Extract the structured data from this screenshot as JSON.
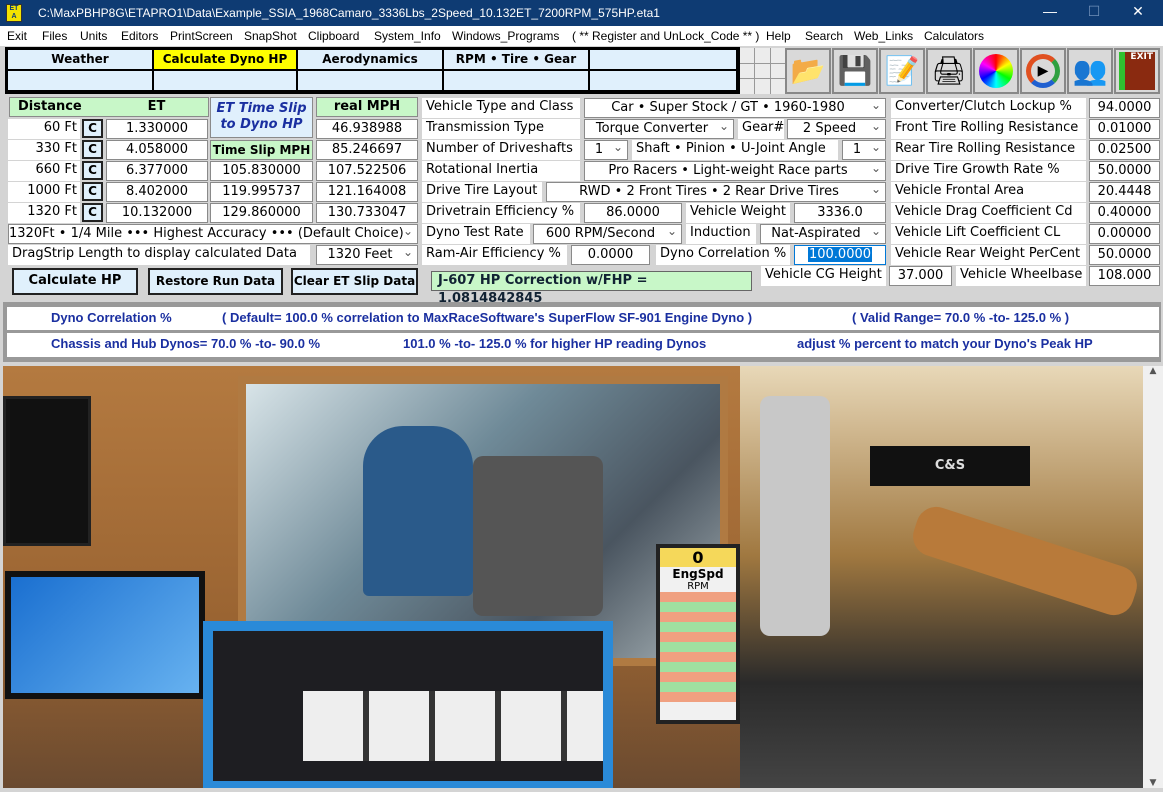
{
  "window": {
    "title": "C:\\MaxPBHP8G\\ETAPRO1\\Data\\Example_SSIA_1968Camaro_3336Lbs_2Speed_10.132ET_7200RPM_575HP.eta1",
    "logo": "ETA",
    "minimize": "—",
    "maximize": "☐",
    "close": "✕"
  },
  "menu": [
    "Exit",
    "Files",
    "Units",
    "Editors",
    "PrintScreen",
    "SnapShot",
    "Clipboard",
    "System_Info",
    "Windows_Programs",
    "( ** Register and UnLock_Code ** )",
    "Help",
    "Search",
    "Web_Links",
    "Calculators"
  ],
  "tabs": [
    "Weather",
    "Calculate Dyno HP",
    "Aerodynamics",
    "RPM  •  Tire  •  Gear",
    ""
  ],
  "toolbar_icons": [
    "open-folder-icon",
    "save-disk-icon",
    "notepad-icon",
    "printer-icon",
    "color-wheel-icon",
    "play-media-icon",
    "users-icon",
    "exit-door-icon"
  ],
  "exit_text": "EXIT",
  "et_panel": {
    "distance_header": "Distance",
    "et_header": "ET",
    "slip_title": "ET Time Slip to Dyno HP",
    "real_mph_header": "real  MPH",
    "time_slip_mph_header": "Time Slip MPH",
    "c_label": "C",
    "rows": [
      {
        "distance": "60 Ft",
        "et": "1.330000",
        "slip_mph": "",
        "real_mph": "46.938988"
      },
      {
        "distance": "330 Ft",
        "et": "4.058000",
        "slip_mph": "",
        "real_mph": "85.246697"
      },
      {
        "distance": "660 Ft",
        "et": "6.377000",
        "slip_mph": "105.830000",
        "real_mph": "107.522506"
      },
      {
        "distance": "1000 Ft",
        "et": "8.402000",
        "slip_mph": "119.995737",
        "real_mph": "121.164008"
      },
      {
        "distance": "1320 Ft",
        "et": "10.132000",
        "slip_mph": "129.860000",
        "real_mph": "130.733047"
      }
    ],
    "accuracy_select": "1320Ft • 1/4 Mile ••• Highest Accuracy ••• (Default Choice)",
    "dragstrip_label": "DragStrip Length to display calculated Data",
    "dragstrip_select": "1320 Feet",
    "calculate_button": "Calculate  HP",
    "restore_button": "Restore Run Data",
    "clear_button": "Clear ET Slip Data"
  },
  "vehicle": {
    "type_label": "Vehicle Type and Class",
    "type_value": "Car  •  Super Stock / GT  •  1960-1980",
    "trans_label": "Transmission Type",
    "trans_value": "Torque Converter",
    "gear_label": "Gear#",
    "gear_value": "2  Speed",
    "driveshafts_label": "Number of Driveshafts",
    "driveshafts_value": "1",
    "angle_label": "Shaft • Pinion • U-Joint Angle",
    "angle_value": "1",
    "inertia_label": "Rotational Inertia",
    "inertia_value": "Pro Racers  •  Light-weight Race parts",
    "tire_layout_label": "Drive Tire Layout",
    "tire_layout_value": "RWD • 2  Front Tires  •  2  Rear Drive Tires",
    "efficiency_label": "Drivetrain Efficiency %",
    "efficiency_value": "86.0000",
    "weight_label": "Vehicle Weight",
    "weight_value": "3336.0",
    "rate_label": "Dyno Test Rate",
    "rate_value": "600 RPM/Second",
    "induction_label": "Induction",
    "induction_value": "Nat-Aspirated",
    "ramair_label": "Ram-Air Efficiency %",
    "ramair_value": "0.0000",
    "correlation_label": "Dyno Correlation %",
    "correlation_value": "100.0000",
    "correction_text": "J-607 HP Correction w/FHP = 1.0814842845",
    "cg_label": "Vehicle CG Height",
    "cg_value": "37.000",
    "wheelbase_label": "Vehicle Wheelbase",
    "wheelbase_value": "108.000"
  },
  "right_params": [
    {
      "label": "Converter/Clutch Lockup %",
      "value": "94.0000"
    },
    {
      "label": "Front Tire Rolling Resistance",
      "value": "0.01000"
    },
    {
      "label": "Rear Tire Rolling Resistance",
      "value": "0.02500"
    },
    {
      "label": "Drive Tire Growth Rate %",
      "value": "50.0000"
    },
    {
      "label": "Vehicle Frontal Area",
      "value": "20.4448"
    },
    {
      "label": "Vehicle Drag Coefficient  Cd",
      "value": "0.40000"
    },
    {
      "label": "Vehicle Lift Coefficient    CL",
      "value": "0.00000"
    },
    {
      "label": "Vehicle Rear Weight PerCent",
      "value": "50.0000"
    }
  ],
  "info": {
    "line1": [
      "Dyno Correlation %",
      "( Default= 100.0 %  correlation to MaxRaceSoftware's SuperFlow SF-901 Engine Dyno )",
      "( Valid Range= 70.0 %  -to-  125.0 % )"
    ],
    "line2": [
      "Chassis and Hub Dynos=  70.0 %  -to-  90.0 %",
      "101.0 %  -to-  125.0 %  for higher HP reading Dynos",
      "adjust % percent to match your Dyno's Peak HP"
    ]
  },
  "photo": {
    "dyno_screen_value": "0",
    "dyno_screen_label": "EngSpd",
    "dyno_screen_unit": "RPM",
    "engine_brand": "C&S"
  },
  "colors": {
    "titlebar": "#0e3b73",
    "tab_active": "#ffff00",
    "header_green": "#c8f7c8",
    "info_text": "#1a2fa0",
    "selection": "#0078d7"
  }
}
